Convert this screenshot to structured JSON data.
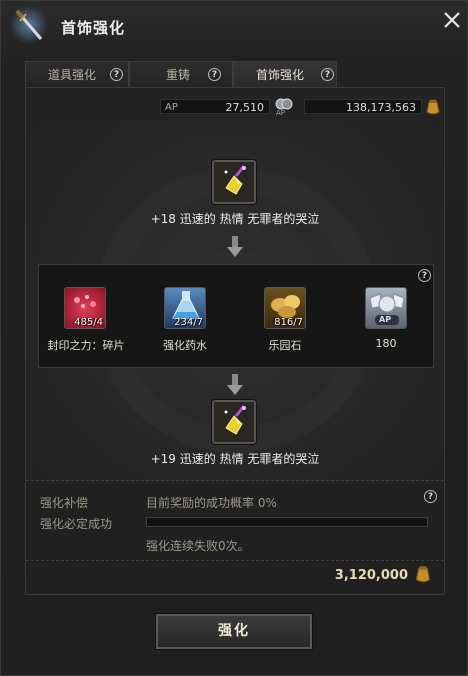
{
  "window": {
    "title": "首饰强化",
    "icon": "dagger-icon",
    "close_icon": "close-icon"
  },
  "tabs": [
    {
      "label": "道具强化",
      "active": false
    },
    {
      "label": "重铸",
      "active": false
    },
    {
      "label": "首饰强化",
      "active": true
    }
  ],
  "currency": {
    "ap_label": "AP",
    "ap_value": "27,510",
    "ap_icon_caption": "AP",
    "gold_value": "138,173,563"
  },
  "current_item": {
    "label": "+18 迅速的 热情 无罪者的哭泣",
    "icon": "yellow-gem-icon"
  },
  "materials": [
    {
      "label": "封印之力：碎片",
      "count": "485/4",
      "icon": "red-shard-icon",
      "color": "#b01828"
    },
    {
      "label": "强化药水",
      "count": "234/7",
      "icon": "potion-flask-icon",
      "color": "#3a6aa0"
    },
    {
      "label": "乐园石",
      "count": "816/7",
      "icon": "gold-ore-icon",
      "color": "#b08a3c"
    },
    {
      "label": "180",
      "count": "",
      "icon": "ap-badge-icon",
      "badge": "AP",
      "color": "#6a7888"
    }
  ],
  "result_item": {
    "label": "+19 迅速的 热情 无罪者的哭泣",
    "icon": "yellow-gem-icon"
  },
  "compensation": {
    "label1": "强化补偿",
    "label2": "强化必定成功",
    "rate_text": "目前奖励的成功概率 0%",
    "progress": 0,
    "fail_text": "强化连续失败0次。"
  },
  "cost": {
    "value": "3,120,000"
  },
  "enhance_button": {
    "label": "强化"
  }
}
